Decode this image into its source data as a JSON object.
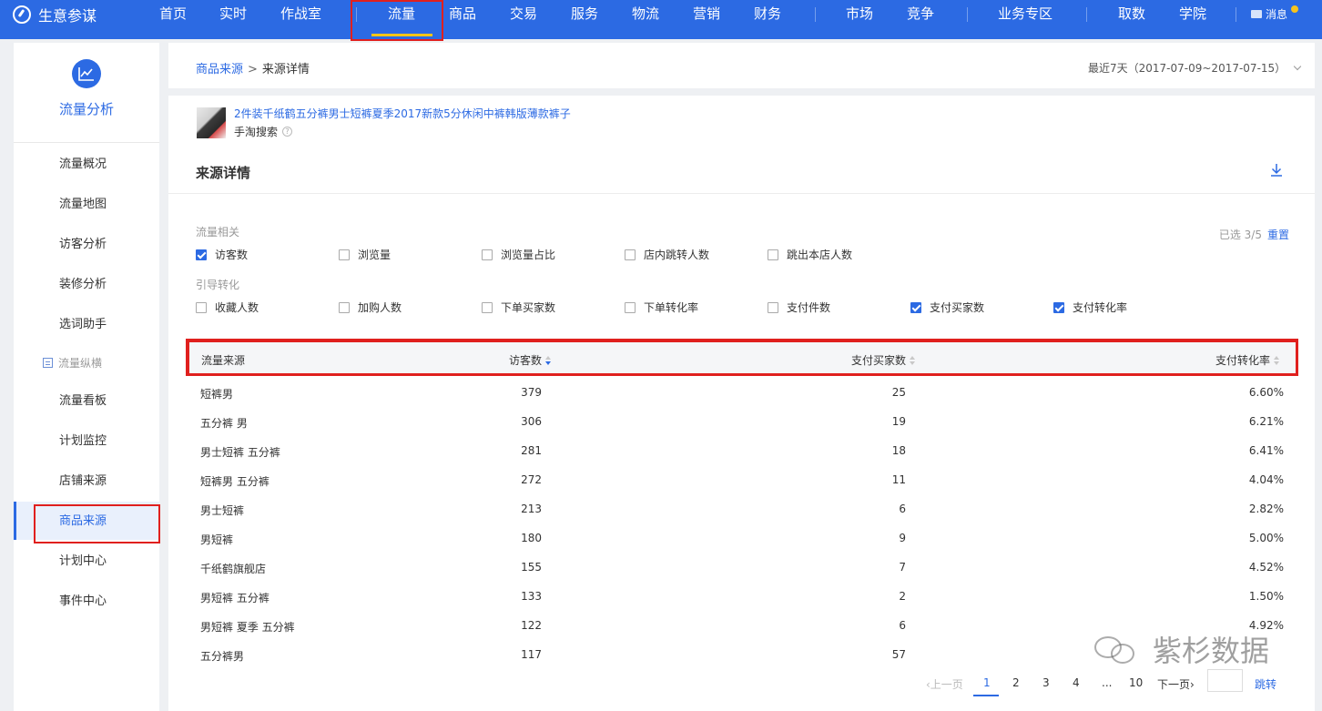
{
  "nav": {
    "brand": "生意参谋",
    "items": [
      "首页",
      "实时",
      "作战室",
      "流量",
      "商品",
      "交易",
      "服务",
      "物流",
      "营销",
      "财务",
      "市场",
      "竞争",
      "业务专区",
      "取数",
      "学院"
    ],
    "active": "流量",
    "message": "消息"
  },
  "sidebar": {
    "title": "流量分析",
    "items": [
      "流量概况",
      "流量地图",
      "访客分析",
      "装修分析",
      "选词助手"
    ],
    "group": "流量纵横",
    "group_items": [
      "流量看板",
      "计划监控",
      "店铺来源",
      "商品来源",
      "计划中心",
      "事件中心"
    ],
    "active": "商品来源"
  },
  "breadcrumb": {
    "parent": "商品来源",
    "sep": ">",
    "current": "来源详情",
    "date_range": "最近7天（2017-07-09~2017-07-15）"
  },
  "product": {
    "title": "2件装千纸鹤五分裤男士短裤夏季2017新款5分休闲中裤韩版薄款裤子",
    "source": "手淘搜索",
    "help": "?"
  },
  "section_title": "来源详情",
  "filters": {
    "group1_label": "流量相关",
    "group1": [
      {
        "label": "访客数",
        "checked": true
      },
      {
        "label": "浏览量",
        "checked": false
      },
      {
        "label": "浏览量占比",
        "checked": false
      },
      {
        "label": "店内跳转人数",
        "checked": false
      },
      {
        "label": "跳出本店人数",
        "checked": false
      }
    ],
    "group2_label": "引导转化",
    "group2": [
      {
        "label": "收藏人数",
        "checked": false
      },
      {
        "label": "加购人数",
        "checked": false
      },
      {
        "label": "下单买家数",
        "checked": false
      },
      {
        "label": "下单转化率",
        "checked": false
      },
      {
        "label": "支付件数",
        "checked": false
      },
      {
        "label": "支付买家数",
        "checked": true
      },
      {
        "label": "支付转化率",
        "checked": true
      }
    ],
    "selected": "已选 3/5",
    "reset": "重置"
  },
  "table": {
    "headers": [
      "流量来源",
      "访客数",
      "支付买家数",
      "支付转化率"
    ],
    "rows": [
      [
        "短裤男",
        "379",
        "25",
        "6.60%"
      ],
      [
        "五分裤 男",
        "306",
        "19",
        "6.21%"
      ],
      [
        "男士短裤 五分裤",
        "281",
        "18",
        "6.41%"
      ],
      [
        "短裤男 五分裤",
        "272",
        "11",
        "4.04%"
      ],
      [
        "男士短裤",
        "213",
        "6",
        "2.82%"
      ],
      [
        "男短裤",
        "180",
        "9",
        "5.00%"
      ],
      [
        "千纸鹤旗舰店",
        "155",
        "7",
        "4.52%"
      ],
      [
        "男短裤 五分裤",
        "133",
        "2",
        "1.50%"
      ],
      [
        "男短裤 夏季 五分裤",
        "122",
        "6",
        "4.92%"
      ],
      [
        "五分裤男",
        "117",
        "57",
        ""
      ]
    ]
  },
  "pagination": {
    "prev": "‹上一页",
    "pages": [
      "1",
      "2",
      "3",
      "4",
      "...",
      "10"
    ],
    "current": "1",
    "next": "下一页›",
    "jump": "跳转"
  },
  "watermark": "紫杉数据",
  "colors": {
    "brand_blue": "#2c6ae3",
    "highlight_red": "#e0201e",
    "active_underline": "#f5c518"
  }
}
